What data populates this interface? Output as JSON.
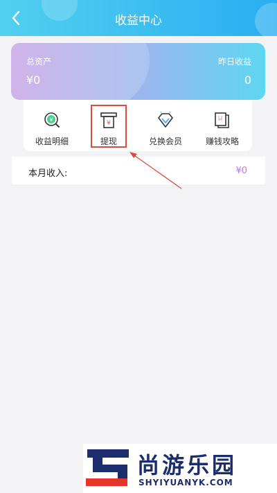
{
  "header": {
    "title": "收益中心",
    "back_icon": "chevron-left-icon",
    "gradient": [
      "#52d0f0",
      "#2aaef2"
    ]
  },
  "assets": {
    "total_label": "总资产",
    "total_value": "¥0",
    "yesterday_label": "昨日收益",
    "yesterday_value": "0"
  },
  "menu": {
    "items": [
      {
        "label": "收益明细",
        "icon": "income-detail-icon"
      },
      {
        "label": "提现",
        "icon": "withdraw-icon"
      },
      {
        "label": "兑换会员",
        "icon": "diamond-icon"
      },
      {
        "label": "赚钱攻略",
        "icon": "guide-book-icon"
      }
    ]
  },
  "income": {
    "label": "本月收入:",
    "value": "¥0",
    "value_color": "#b07fe0"
  },
  "annotation": {
    "color": "#e04a3c"
  },
  "watermark": {
    "brand": "尚游乐园",
    "domain": "SHYIYUANYK.COM"
  }
}
